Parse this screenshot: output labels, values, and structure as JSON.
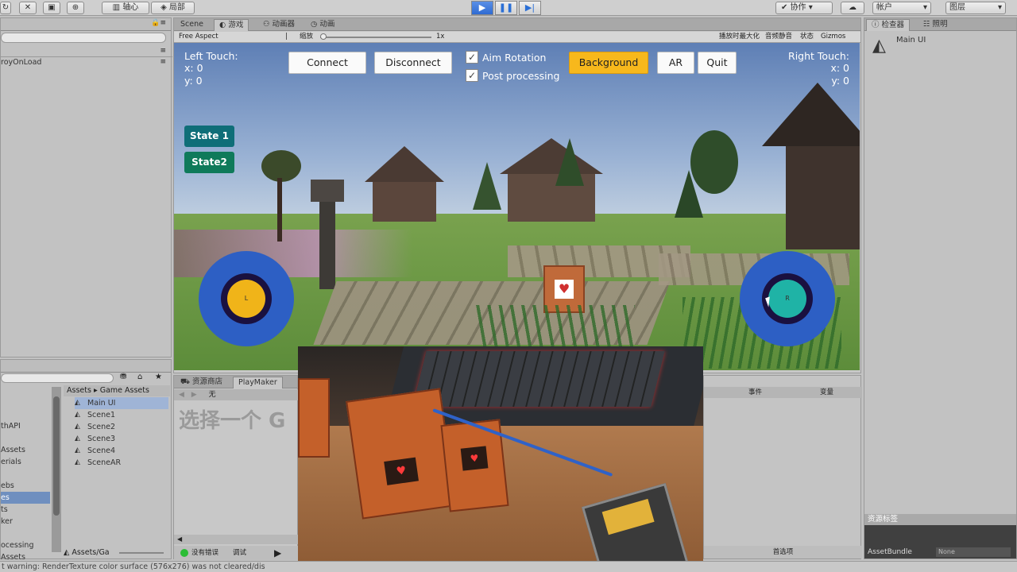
{
  "toolbar": {
    "pivot_label": "轴心",
    "local_label": "局部",
    "collab_label": "协作",
    "account_label": "帐户",
    "layers_label": "图层"
  },
  "left_top": {
    "dont_destroy": "royOnLoad"
  },
  "scene_tabs": {
    "scene": "Scene",
    "game": "游戏",
    "animator": "动画器",
    "animation": "动画"
  },
  "game_toolbar": {
    "aspect": "Free Aspect",
    "scale_label": "缩放",
    "scale_value": "1x",
    "maximize": "播放时最大化",
    "mute": "音频静音",
    "stats": "状态",
    "gizmos": "Gizmos"
  },
  "game": {
    "left_touch_label": "Left Touch:",
    "left_x": "x: 0",
    "left_y": "y: 0",
    "right_touch_label": "Right Touch:",
    "right_x": "x: 0",
    "right_y": "y: 0",
    "connect": "Connect",
    "disconnect": "Disconnect",
    "aim_rotation": "Aim Rotation",
    "post_processing": "Post processing",
    "background": "Background",
    "ar": "AR",
    "quit": "Quit",
    "state1": "State 1",
    "state2": "State2",
    "left_knob": "L",
    "right_knob": "R",
    "colors": {
      "background_btn": "#f7b81c",
      "state1": "#0f6e78",
      "state2": "#0f7a5a",
      "joystick": "#2d5fc4",
      "left_knob": "#f0b419",
      "right_knob": "#1fb3a6"
    }
  },
  "inspector": {
    "tab_inspector": "检查器",
    "tab_lighting": "照明",
    "object_name": "Main UI",
    "asset_labels_title": "资源标签",
    "asset_bundle": "AssetBundle",
    "none": "None"
  },
  "project": {
    "tab_store": "资源商店",
    "tab_playmaker": "PlayMaker",
    "breadcrumb_assets": "Assets",
    "breadcrumb_game_assets": "Game Assets",
    "playmaker_placeholder": "选择一个 G",
    "none_label": "无",
    "items": [
      "Main UI",
      "Scene1",
      "Scene2",
      "Scene3",
      "Scene4",
      "SceneAR"
    ],
    "left_folders": [
      "thAPI",
      "Assets",
      "erials",
      "ebs",
      "es",
      "ts",
      "ker",
      "ocessing",
      "Assets"
    ],
    "bottom_path": "Assets/Ga",
    "events_col": "事件",
    "variables_col": "变量",
    "debug_label": "调试",
    "error_label": "没有错误",
    "prefs_label": "首选项"
  },
  "status": {
    "warning": "t warning: RenderTexture color surface (576x276) was not cleared/dis"
  }
}
